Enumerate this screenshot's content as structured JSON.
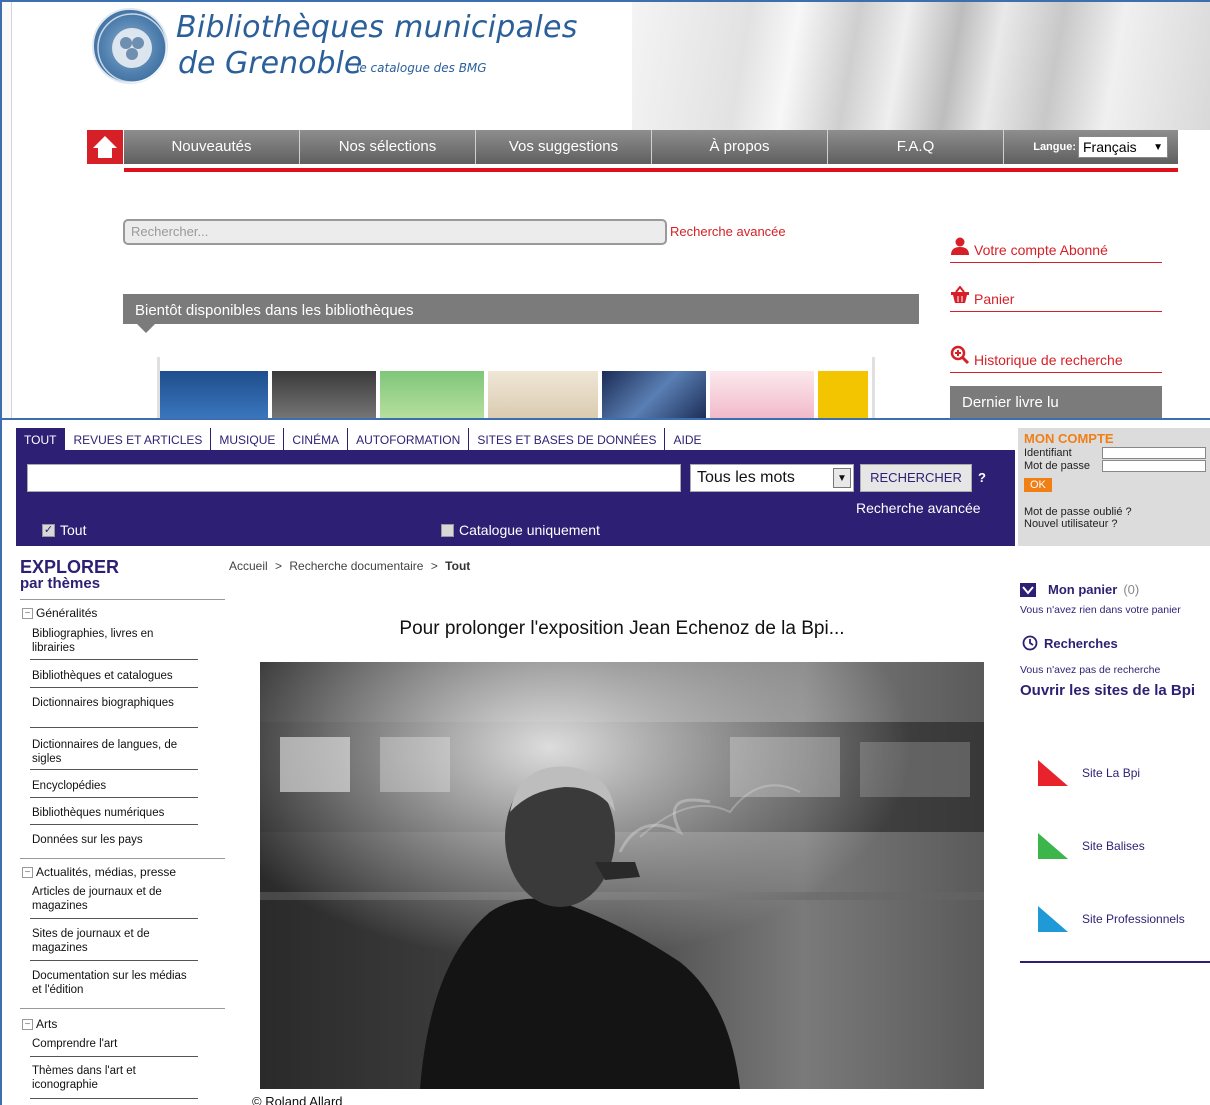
{
  "bmg": {
    "title_line1": "Bibliothèques municipales",
    "title_line2": "de Grenoble",
    "subtitle": "le catalogue des BMG",
    "nav": [
      "Nouveautés",
      "Nos sélections",
      "Vos suggestions",
      "À propos",
      "F.A.Q"
    ],
    "lang_label": "Langue:",
    "lang_value": "Français",
    "search_placeholder": "Rechercher...",
    "advanced_search": "Recherche avancée",
    "account": "Votre compte Abonné",
    "cart": "Panier",
    "history": "Historique de recherche",
    "soon": "Bientôt disponibles dans les bibliothèques",
    "last_read": "Dernier livre lu",
    "colors": {
      "accent": "#d61f26",
      "title": "#2a5f9a",
      "nav": "#6f6f6f"
    }
  },
  "bpi": {
    "tabs": [
      "TOUT",
      "REVUES ET ARTICLES",
      "MUSIQUE",
      "CINÉMA",
      "AUTOFORMATION",
      "SITES ET BASES DE DONNÉES",
      "AIDE"
    ],
    "search_value": "",
    "mode_select": "Tous les mots",
    "search_button": "RECHERCHER",
    "help": "?",
    "advanced_search": "Recherche avancée",
    "check_all": "Tout",
    "check_catalog": "Catalogue uniquement",
    "account": {
      "title": "MON COMPTE",
      "id_label": "Identifiant",
      "pw_label": "Mot de passe",
      "ok": "OK",
      "forgot": "Mot de passe oublié ?",
      "new_user": "Nouvel utilisateur ?"
    },
    "explorer_title": "EXPLORER",
    "explorer_sub": "par thèmes",
    "categories": [
      {
        "label": "Généralités",
        "items": [
          "Bibliographies, livres en librairies",
          "Bibliothèques et catalogues",
          "Dictionnaires biographiques",
          "Dictionnaires de langues, de sigles",
          "Encyclopédies",
          "Bibliothèques numériques",
          "Données sur les pays"
        ]
      },
      {
        "label": "Actualités, médias, presse",
        "items": [
          "Articles de journaux et de magazines",
          "Sites de journaux et de magazines",
          "Documentation sur les médias et l'édition"
        ]
      },
      {
        "label": "Arts",
        "items": [
          "Comprendre l'art",
          "Thèmes dans l'art et iconographie"
        ]
      }
    ],
    "breadcrumb": {
      "home": "Accueil",
      "sep": ">",
      "mid": "Recherche documentaire",
      "current": "Tout"
    },
    "headline": "Pour prolonger l'exposition Jean Echenoz de la Bpi...",
    "credit": "© Roland Allard",
    "cart_title": "Mon panier",
    "cart_count": "(0)",
    "cart_empty": "Vous n'avez rien dans votre panier",
    "searches_title": "Recherches",
    "searches_empty": "Vous n'avez pas de recherche",
    "open_sites": "Ouvrir les sites de la Bpi",
    "sites": [
      {
        "label": "Site La Bpi",
        "color": "#e8232b"
      },
      {
        "label": "Site Balises",
        "color": "#3cb54a"
      },
      {
        "label": "Site Professionnels",
        "color": "#1f9ad6"
      }
    ],
    "colors": {
      "primary": "#2d1f73",
      "orange": "#f07f16"
    }
  }
}
